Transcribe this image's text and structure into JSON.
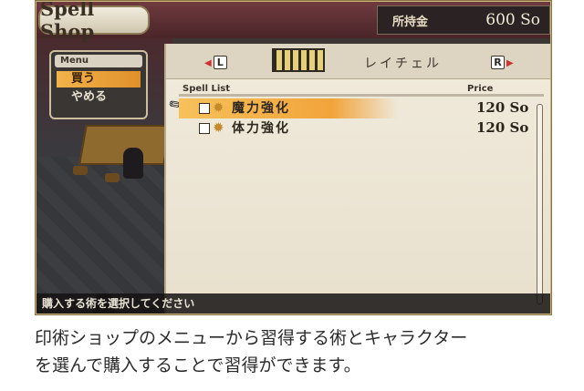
{
  "title": "Spell Shop",
  "money": {
    "label": "所持金",
    "value": "600 So"
  },
  "menu": {
    "header": "Menu",
    "items": [
      {
        "label": "買う",
        "selected": true
      },
      {
        "label": "やめる",
        "selected": false
      }
    ]
  },
  "character_bar": {
    "left_button": "L",
    "right_button": "R",
    "character_name": "レイチェル"
  },
  "spell_list": {
    "header": "Spell List",
    "price_header": "Price",
    "items": [
      {
        "name": "魔力強化",
        "price": "120 So",
        "selected": true
      },
      {
        "name": "体力強化",
        "price": "120 So",
        "selected": false
      }
    ]
  },
  "help_text": "購入する術を選択してください",
  "caption": {
    "line1": "印術ショップのメニューから習得する術とキャラクター",
    "line2": "を選んで購入することで習得ができます。"
  },
  "colors": {
    "highlight": "#f1a43a",
    "frame": "#c9b57c",
    "title_bg": "#5a2d32"
  }
}
